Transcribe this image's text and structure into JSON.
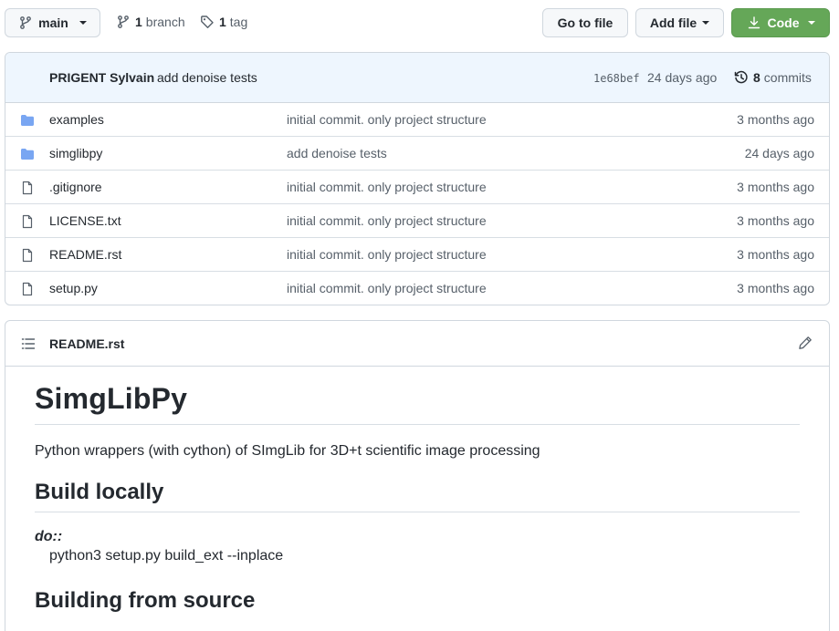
{
  "toolbar": {
    "branch_name": "main",
    "branch_count": "1",
    "branch_label": "branch",
    "tag_count": "1",
    "tag_label": "tag",
    "go_to_file": "Go to file",
    "add_file": "Add file",
    "code": "Code"
  },
  "commit": {
    "author": "PRIGENT Sylvain",
    "message": "add denoise tests",
    "sha": "1e68bef",
    "age": "24 days ago",
    "count": "8",
    "count_label": "commits"
  },
  "files": [
    {
      "name": "examples",
      "type": "folder",
      "message": "initial commit. only project structure",
      "age": "3 months ago"
    },
    {
      "name": "simglibpy",
      "type": "folder",
      "message": "add denoise tests",
      "age": "24 days ago"
    },
    {
      "name": ".gitignore",
      "type": "file",
      "message": "initial commit. only project structure",
      "age": "3 months ago"
    },
    {
      "name": "LICENSE.txt",
      "type": "file",
      "message": "initial commit. only project structure",
      "age": "3 months ago"
    },
    {
      "name": "README.rst",
      "type": "file",
      "message": "initial commit. only project structure",
      "age": "3 months ago"
    },
    {
      "name": "setup.py",
      "type": "file",
      "message": "initial commit. only project structure",
      "age": "3 months ago"
    }
  ],
  "readme": {
    "filename": "README.rst",
    "title": "SimgLibPy",
    "description": "Python wrappers (with cython) of SImgLib for 3D+t scientific image processing",
    "section1": "Build locally",
    "term": "do::",
    "command": "python3 setup.py build_ext --inplace",
    "section2": "Building from source"
  },
  "colors": {
    "code_button": "#65a758",
    "folder_icon": "#79a6f2",
    "commit_bar": "#eef6fe"
  }
}
